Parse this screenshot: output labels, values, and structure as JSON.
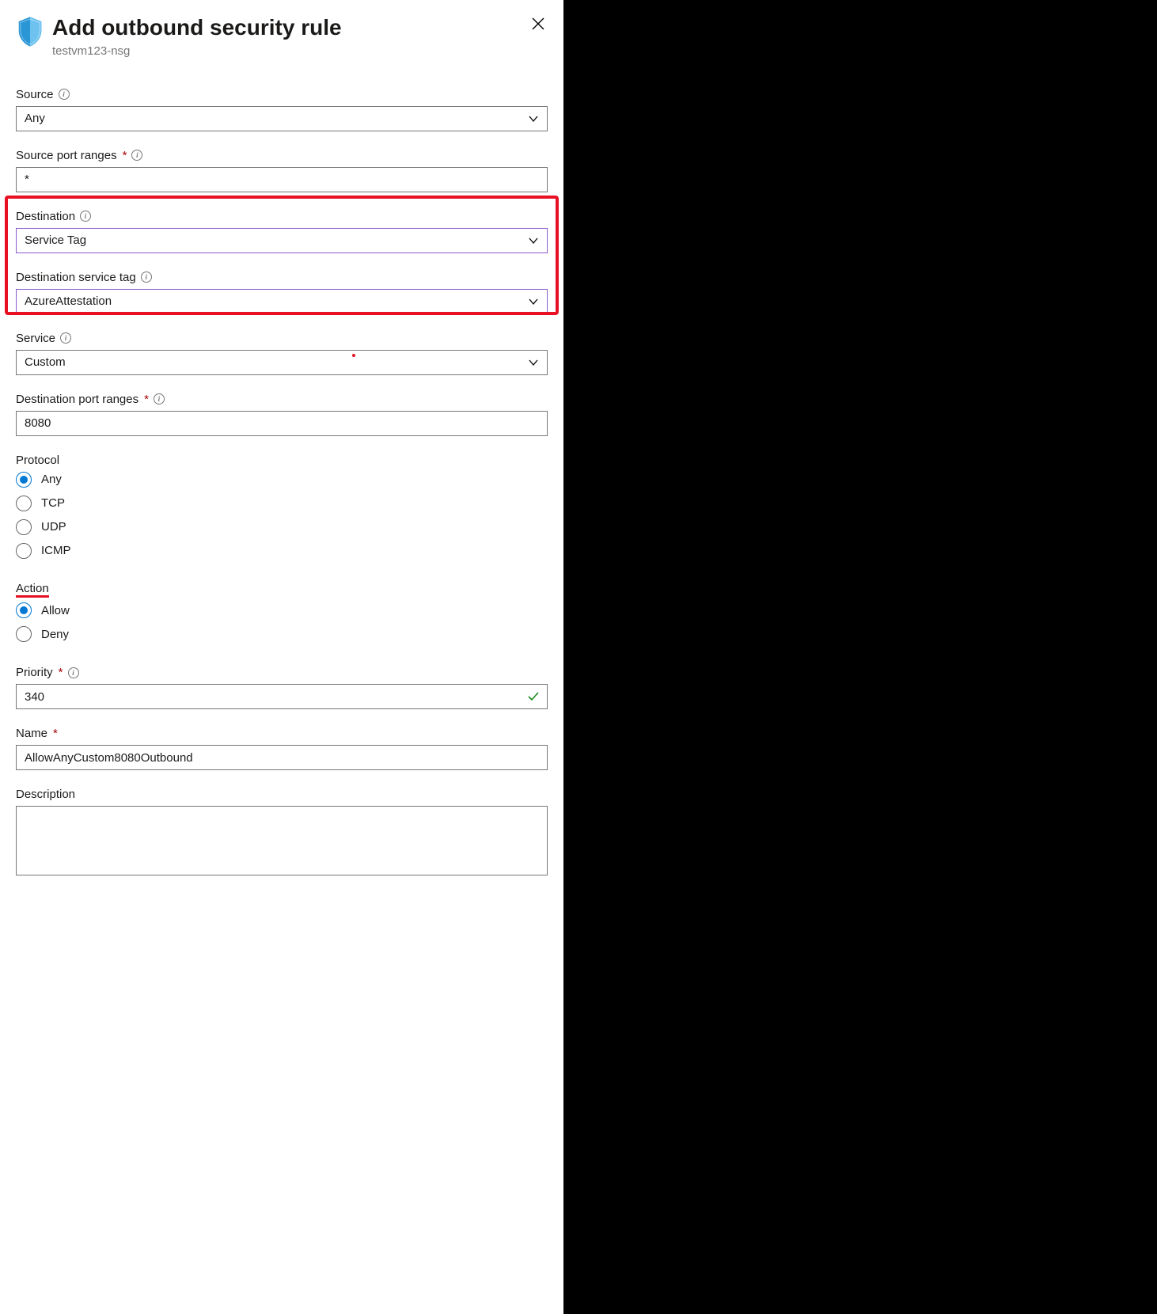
{
  "header": {
    "title": "Add outbound security rule",
    "subtitle": "testvm123-nsg"
  },
  "fields": {
    "source": {
      "label": "Source",
      "value": "Any"
    },
    "sourcePortRanges": {
      "label": "Source port ranges",
      "value": "*"
    },
    "destination": {
      "label": "Destination",
      "value": "Service Tag"
    },
    "destServiceTag": {
      "label": "Destination service tag",
      "value": "AzureAttestation"
    },
    "service": {
      "label": "Service",
      "value": "Custom"
    },
    "destPortRanges": {
      "label": "Destination port ranges",
      "value": "8080"
    },
    "protocol": {
      "label": "Protocol",
      "options": [
        "Any",
        "TCP",
        "UDP",
        "ICMP"
      ],
      "selected": "Any"
    },
    "action": {
      "label": "Action",
      "options": [
        "Allow",
        "Deny"
      ],
      "selected": "Allow"
    },
    "priority": {
      "label": "Priority",
      "value": "340"
    },
    "name": {
      "label": "Name",
      "value": "AllowAnyCustom8080Outbound"
    },
    "description": {
      "label": "Description",
      "value": ""
    }
  }
}
